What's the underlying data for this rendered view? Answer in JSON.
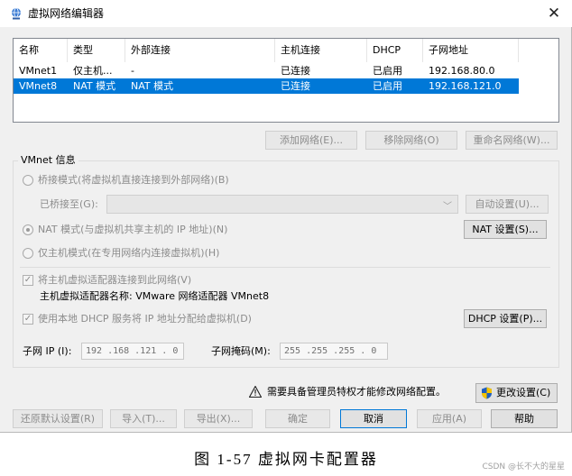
{
  "window": {
    "title": "虚拟网络编辑器",
    "close_glyph": "✕"
  },
  "table": {
    "columns": [
      "名称",
      "类型",
      "外部连接",
      "主机连接",
      "DHCP",
      "子网地址"
    ],
    "rows": [
      {
        "name": "VMnet1",
        "type": "仅主机...",
        "external": "-",
        "host": "已连接",
        "dhcp": "已启用",
        "subnet": "192.168.80.0",
        "selected": false
      },
      {
        "name": "VMnet8",
        "type": "NAT 模式",
        "external": "NAT 模式",
        "host": "已连接",
        "dhcp": "已启用",
        "subnet": "192.168.121.0",
        "selected": true
      }
    ]
  },
  "table_buttons": {
    "add": "添加网络(E)...",
    "remove": "移除网络(O)",
    "rename": "重命名网络(W)..."
  },
  "vmnet_info": {
    "title": "VMnet 信息",
    "bridged_label": "桥接模式(将虚拟机直接连接到外部网络)(B)",
    "bridged_to_label": "已桥接至(G):",
    "bridged_to_value": "",
    "auto_settings": "自动设置(U)...",
    "nat_label": "NAT 模式(与虚拟机共享主机的 IP 地址)(N)",
    "nat_settings": "NAT 设置(S)...",
    "hostonly_label": "仅主机模式(在专用网络内连接虚拟机)(H)",
    "connect_adapter_label": "将主机虚拟适配器连接到此网络(V)",
    "adapter_name_label": "主机虚拟适配器名称: VMware 网络适配器 VMnet8",
    "dhcp_label": "使用本地 DHCP 服务将 IP 地址分配给虚拟机(D)",
    "dhcp_settings": "DHCP 设置(P)...",
    "subnet_ip_label": "子网 IP (I):",
    "subnet_ip_value": "192 .168 .121 . 0",
    "subnet_mask_label": "子网掩码(M):",
    "subnet_mask_value": "255 .255 .255 . 0",
    "selected_mode": "nat",
    "connect_adapter_checked": true,
    "dhcp_checked": true
  },
  "admin": {
    "warning_text": "需要具备管理员特权才能修改网络配置。",
    "change_settings": "更改设置(C)"
  },
  "footer_buttons": {
    "restore": "还原默认设置(R)",
    "import": "导入(T)...",
    "export": "导出(X)...",
    "ok": "确定",
    "cancel": "取消",
    "apply": "应用(A)",
    "help": "帮助"
  },
  "caption": "图 1-57 虚拟网卡配置器",
  "watermark": "CSDN @长不大的星星",
  "colors": {
    "selection": "#0078d7",
    "dialog_bg": "#f0f0f0",
    "disabled_text": "#8c8c8c"
  },
  "icons": {
    "title": "network-globe-icon",
    "close": "close-icon",
    "warning": "warning-icon",
    "shield": "uac-shield-icon",
    "dropdown": "chevron-down-icon"
  }
}
